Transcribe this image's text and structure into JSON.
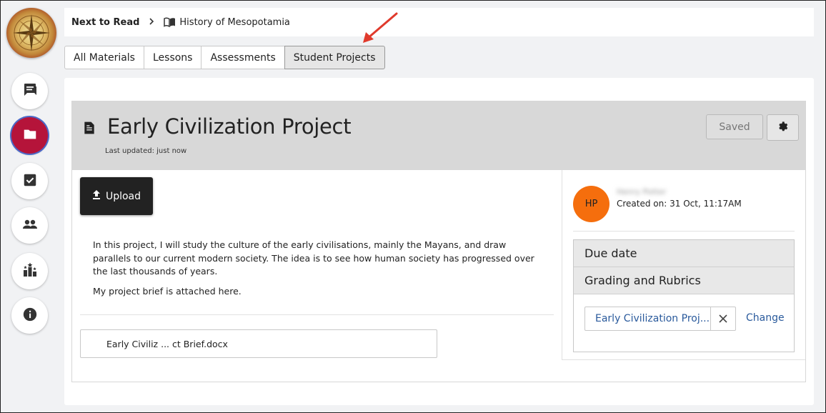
{
  "sidebar": {
    "logo": "compass-logo",
    "items": [
      {
        "icon": "chat-icon",
        "active": false
      },
      {
        "icon": "folder-icon",
        "active": true
      },
      {
        "icon": "checkbox-icon",
        "active": false
      },
      {
        "icon": "people-icon",
        "active": false
      },
      {
        "icon": "leaderboard-icon",
        "active": false
      },
      {
        "icon": "info-icon",
        "active": false
      }
    ],
    "active_color": "#b5143a"
  },
  "breadcrumb": {
    "next_label": "Next to Read",
    "book_title": "History of Mesopotamia"
  },
  "tabs": [
    {
      "label": "All Materials",
      "active": false
    },
    {
      "label": "Lessons",
      "active": false
    },
    {
      "label": "Assessments",
      "active": false
    },
    {
      "label": "Student Projects",
      "active": true
    }
  ],
  "project": {
    "title": "Early Civilization Project",
    "last_updated": "Last updated: just now",
    "saved_label": "Saved",
    "upload_label": "Upload",
    "description": [
      "In this project, I will study the culture of the early civilisations, mainly the Mayans, and draw parallels to our current modern society. The idea is to see how human society has progressed over the last thousands of years.",
      "My project brief is attached here."
    ],
    "attachment_name": "Early Civiliz ... ct Brief.docx"
  },
  "author": {
    "initials": "HP",
    "name": "Henry Potter",
    "created": "Created on: 31 Oct, 11:17AM",
    "avatar_color": "#f56e0d"
  },
  "settings": {
    "due_date_label": "Due date",
    "grading_label": "Grading and Rubrics",
    "rubric_value": "Early Civilization Proj...",
    "change_label": "Change"
  },
  "annotation_arrow_color": "#e03a2c"
}
